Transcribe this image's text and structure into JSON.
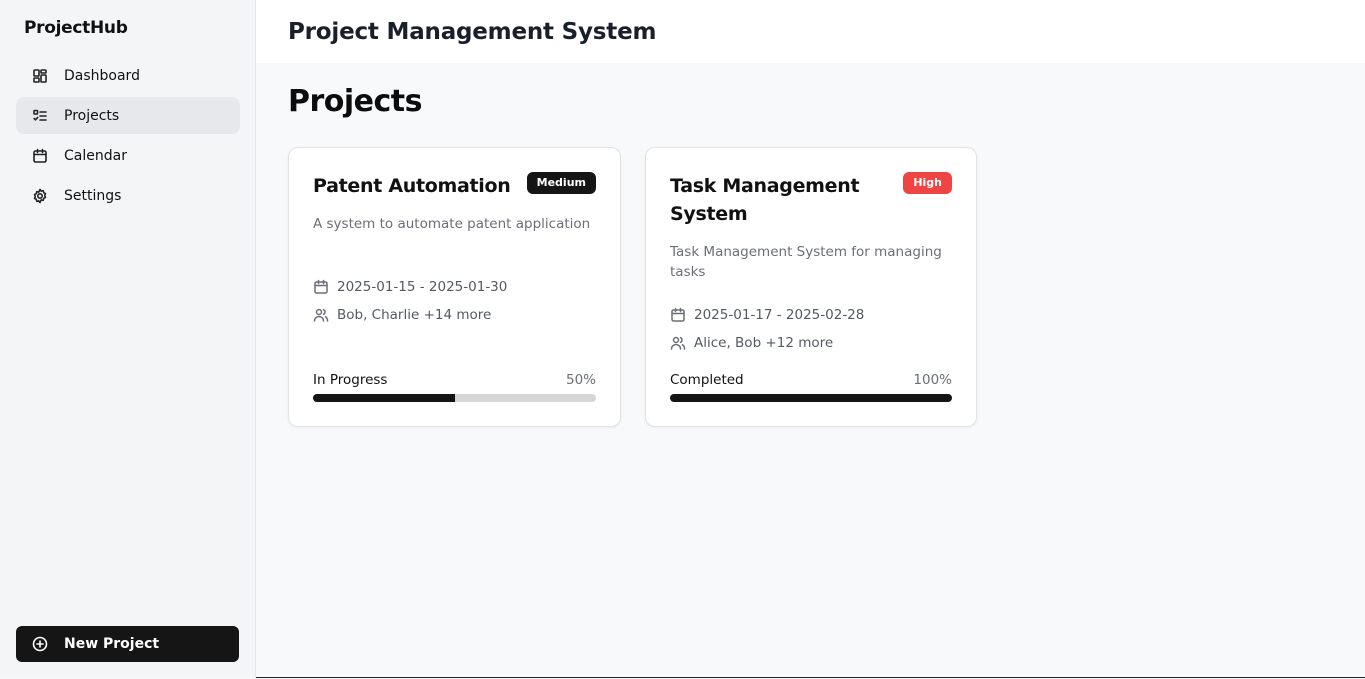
{
  "sidebar": {
    "brand": "ProjectHub",
    "items": [
      {
        "label": "Dashboard",
        "icon": "dashboard-icon",
        "active": false
      },
      {
        "label": "Projects",
        "icon": "projects-list-icon",
        "active": true
      },
      {
        "label": "Calendar",
        "icon": "calendar-icon",
        "active": false
      },
      {
        "label": "Settings",
        "icon": "gear-icon",
        "active": false
      }
    ],
    "new_project_label": "New Project"
  },
  "header": {
    "title": "Project Management System"
  },
  "main": {
    "section_title": "Projects",
    "projects": [
      {
        "title": "Patent Automation",
        "priority": "Medium",
        "description": "A system to automate patent application",
        "dates": "2025-01-15 - 2025-01-30",
        "members": "Bob, Charlie +14 more",
        "status": "In Progress",
        "progress_label": "50%",
        "progress": 0.5
      },
      {
        "title": "Task Management System",
        "priority": "High",
        "description": "Task Management System for managing tasks",
        "dates": "2025-01-17 - 2025-02-28",
        "members": "Alice, Bob +12 more",
        "status": "Completed",
        "progress_label": "100%",
        "progress": 1.0
      }
    ]
  },
  "colors": {
    "accent_dark": "#151515",
    "priority_high": "#ef4444",
    "priority_medium": "#151515"
  }
}
